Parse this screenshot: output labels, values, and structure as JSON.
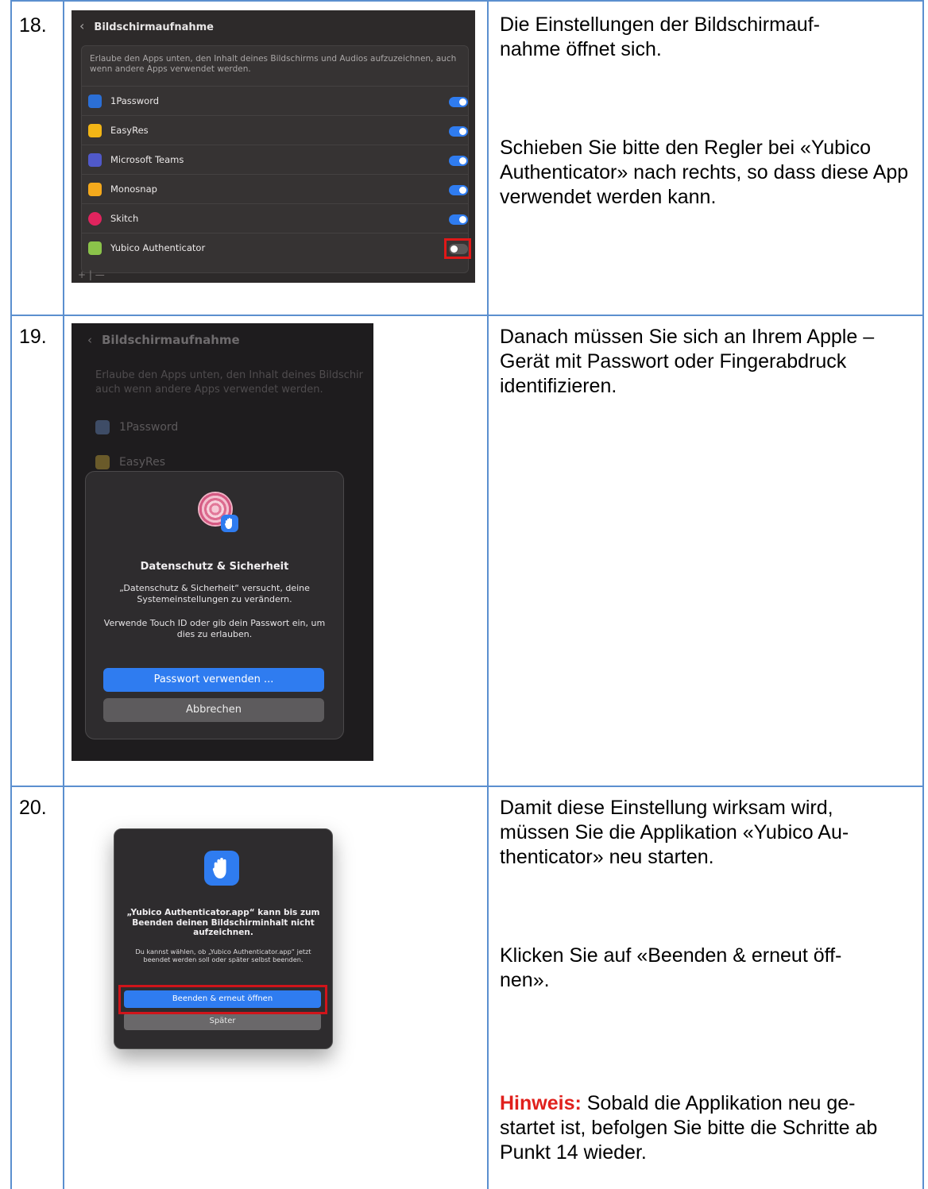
{
  "steps": [
    {
      "number": "18.",
      "text": [
        "Die Einstellungen der Bildschirmauf-nahme öffnet sich.",
        "Schieben Sie bitte den Regler bei «Yubico Authenticator» nach rechts, so dass diese App verwendet werden kann."
      ],
      "screenshot": {
        "back_icon": "chevron-left-icon",
        "title": "Bildschirmaufnahme",
        "description": "Erlaube den Apps unten, den Inhalt deines Bildschirms und Audios aufzuzeichnen, auch wenn andere Apps verwendet werden.",
        "apps": [
          {
            "name": "1Password",
            "icon": "1password-icon",
            "color": "#2b6fd6",
            "enabled": true
          },
          {
            "name": "EasyRes",
            "icon": "easyres-icon",
            "color": "#f2b516",
            "enabled": true
          },
          {
            "name": "Microsoft Teams",
            "icon": "teams-icon",
            "color": "#5059c9",
            "enabled": true
          },
          {
            "name": "Monosnap",
            "icon": "monosnap-icon",
            "color": "#f4a91c",
            "enabled": true
          },
          {
            "name": "Skitch",
            "icon": "skitch-icon",
            "color": "#e0245e",
            "enabled": true
          },
          {
            "name": "Yubico Authenticator",
            "icon": "yubico-icon",
            "color": "#8bc34a",
            "enabled": false
          }
        ],
        "footer": "+ | —"
      }
    },
    {
      "number": "19.",
      "text": [
        "Danach müssen Sie sich an Ihrem Apple – Gerät mit Passwort oder Fingerabdruck identifizieren."
      ],
      "screenshot": {
        "title": "Bildschirmaufnahme",
        "description_line1": "Erlaube den Apps unten, den Inhalt deines Bildschir",
        "description_line2": "auch wenn andere Apps verwendet werden.",
        "bg_apps": [
          "1Password",
          "EasyRes"
        ],
        "dialog_title": "Datenschutz & Sicherheit",
        "dialog_text1": "„Datenschutz & Sicherheit“ versucht, deine Systemeinstellungen zu verändern.",
        "dialog_text2": "Verwende Touch ID oder gib dein Passwort ein, um dies zu erlauben.",
        "primary_button": "Passwort verwenden ...",
        "secondary_button": "Abbrechen"
      }
    },
    {
      "number": "20.",
      "text": [
        "Damit diese Einstellung wirksam wird, müssen Sie die Applikation «Yubico Au-thenticator» neu starten.",
        "Klicken Sie auf «Beenden & erneut öff-nen»."
      ],
      "hint_label": "Hinweis:",
      "hint_text": " Sobald die Applikation neu ge-startet ist, befolgen Sie bitte die Schritte ab Punkt 14 wieder.",
      "screenshot": {
        "title": "„Yubico Authenticator.app“ kann bis zum Beenden deinen Bildschirminhalt nicht aufzeichnen.",
        "text": "Du kannst wählen, ob „Yubico Authenticator.app“ jetzt beendet werden soll oder später selbst beenden.",
        "primary_button": "Beenden & erneut öffnen",
        "secondary_button": "Später"
      }
    }
  ],
  "colors": {
    "table_border": "#5b8fcf",
    "toggle_on": "#2f7cf0",
    "highlight": "#e01818",
    "hint": "#e0201c"
  }
}
